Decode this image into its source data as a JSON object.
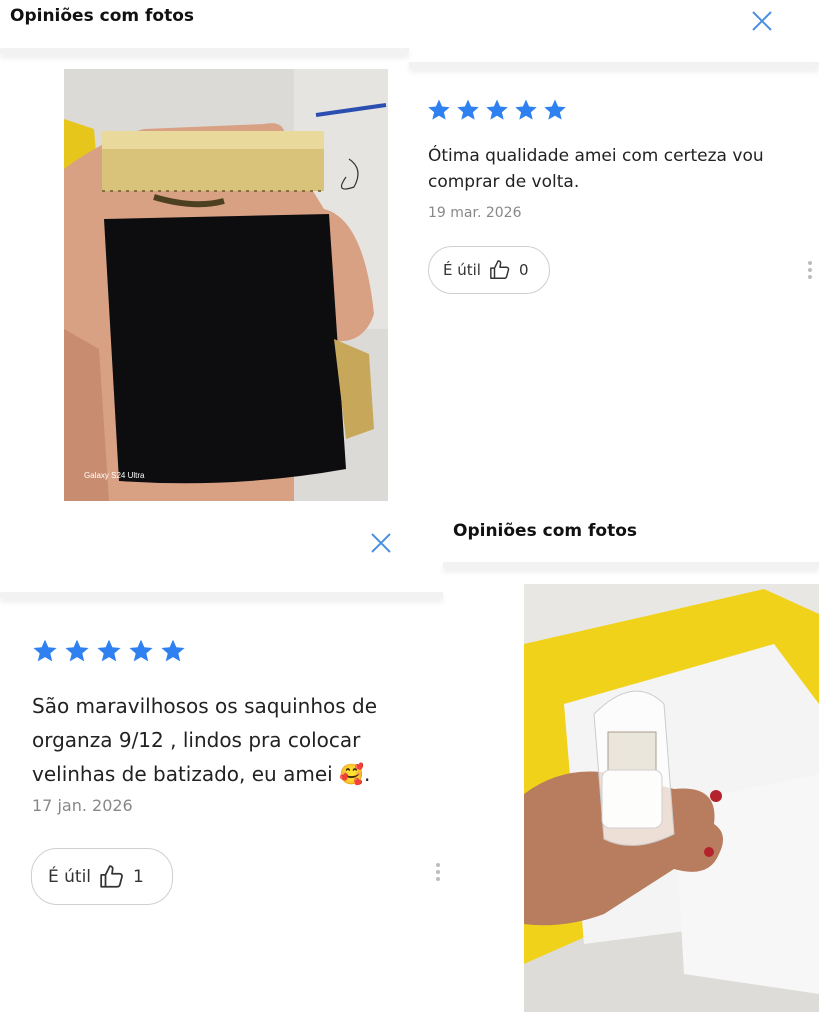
{
  "top_panel": {
    "title": "Opiniões com fotos",
    "close_icon": "close-icon"
  },
  "review_1": {
    "stars": 5,
    "star_color": "#2f80f1",
    "text": "Ótima qualidade amei com certeza vou comprar de volta.",
    "date": "19 mar. 2026",
    "useful_label": "É útil",
    "useful_count": "0",
    "photo_caption": "Galaxy S24 Ultra"
  },
  "middle_panel": {
    "close_icon": "close-icon"
  },
  "review_2": {
    "stars": 5,
    "star_color": "#2f80f1",
    "text": "São maravilhosos os saquinhos de organza 9/12 , lindos pra colocar velinhas de batizado, eu amei 🥰.",
    "date": "17 jan. 2026",
    "useful_label": "É útil",
    "useful_count": "1"
  },
  "bottom_panel": {
    "title": "Opiniões com fotos"
  }
}
